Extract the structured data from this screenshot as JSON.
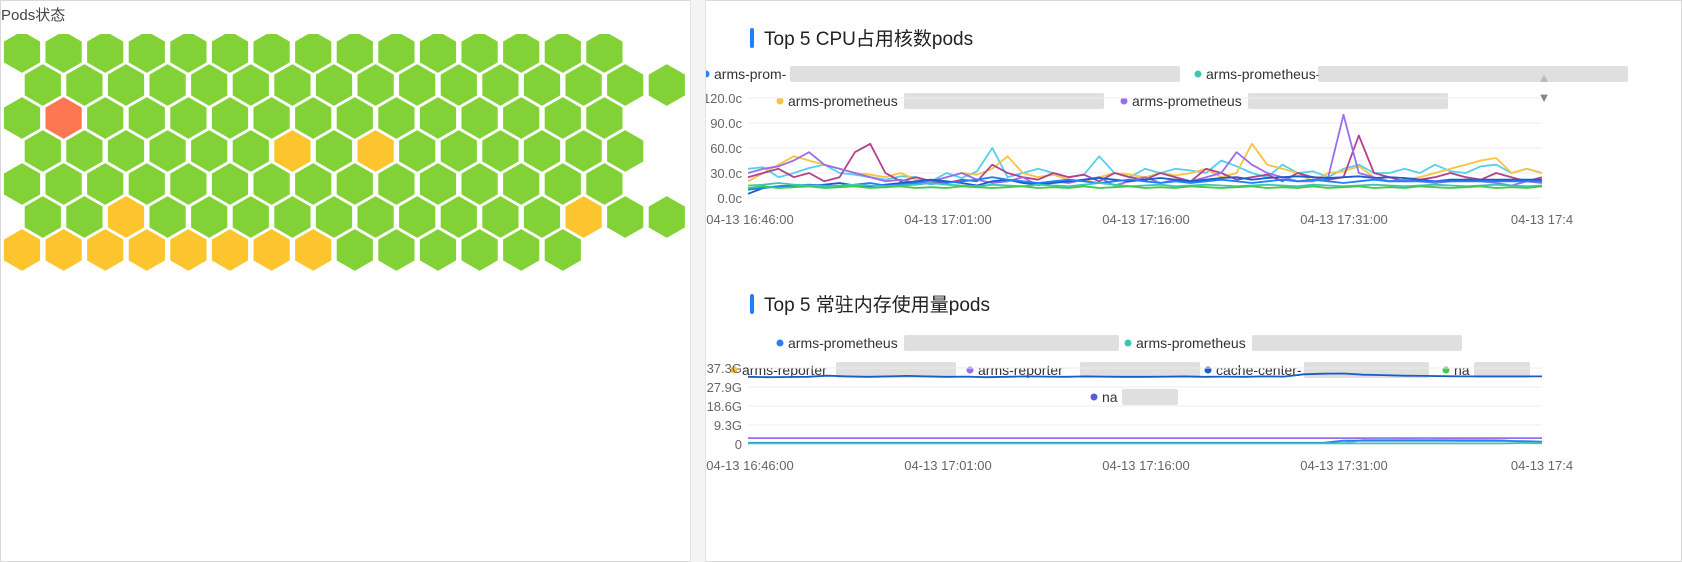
{
  "pods_panel": {
    "title": "Pods状态",
    "status_colors": {
      "running": "#82d136",
      "warning": "#fcc42d",
      "error": "#fc7752"
    },
    "rows": [
      "ggggggggggggggg",
      "gggggggggggggggg",
      "geggggggggggggg",
      "ggggggwgwgggggg",
      "ggggggggggggggg",
      "ggwggggggggggwggg",
      "wwwwwwwwgggggg"
    ]
  },
  "cpu_chart": {
    "title": "Top 5 CPU占用核数pods",
    "legend": [
      {
        "label": "arms-prom-",
        "color": "#2f7ef0"
      },
      {
        "label": "arms-prometheus-",
        "color": "#3cc7b4"
      },
      {
        "label": "arms-prometheus",
        "color": "#f7c340"
      },
      {
        "label": "arms-prometheus",
        "color": "#9a6cf0"
      }
    ],
    "legend_pager": {
      "up": "▲",
      "down": "▼"
    },
    "chart_data": {
      "type": "line",
      "y_ticks": [
        "120.0c",
        "90.0c",
        "60.0c",
        "30.0c",
        "0.0c"
      ],
      "x_ticks": [
        "04-13 16:46:00",
        "04-13 17:01:00",
        "04-13 17:16:00",
        "04-13 17:31:00",
        "04-13 17:4"
      ],
      "ylim": [
        0,
        120
      ],
      "series": [
        {
          "color": "#55d0ec",
          "values": [
            35,
            37,
            25,
            30,
            36,
            40,
            30,
            28,
            25,
            22,
            26,
            25,
            20,
            30,
            24,
            32,
            60,
            25,
            30,
            35,
            30,
            25,
            28,
            50,
            30,
            25,
            35,
            30,
            35,
            33,
            30,
            45,
            38,
            30,
            25,
            40,
            30,
            32,
            25,
            35,
            40,
            30,
            30,
            35,
            30,
            40,
            32,
            30,
            38,
            40,
            30,
            35,
            30
          ]
        },
        {
          "color": "#f7c340",
          "values": [
            20,
            30,
            40,
            50,
            45,
            40,
            35,
            30,
            28,
            25,
            30,
            22,
            20,
            25,
            30,
            28,
            35,
            50,
            30,
            25,
            28,
            22,
            20,
            25,
            30,
            28,
            25,
            30,
            27,
            30,
            35,
            25,
            30,
            65,
            40,
            35,
            30,
            20,
            30,
            32,
            38,
            25,
            20,
            22,
            25,
            30,
            35,
            40,
            45,
            48,
            30,
            35,
            30
          ]
        },
        {
          "color": "#b5418c",
          "values": [
            25,
            30,
            35,
            25,
            30,
            20,
            25,
            55,
            65,
            30,
            20,
            25,
            20,
            18,
            22,
            20,
            40,
            30,
            25,
            22,
            30,
            25,
            28,
            20,
            30,
            25,
            22,
            30,
            25,
            20,
            35,
            30,
            22,
            25,
            28,
            20,
            30,
            25,
            22,
            25,
            75,
            30,
            25,
            20,
            22,
            25,
            30,
            25,
            22,
            30,
            25,
            20,
            25
          ]
        },
        {
          "color": "#9a6cf0",
          "values": [
            30,
            35,
            38,
            45,
            55,
            40,
            35,
            30,
            25,
            20,
            22,
            18,
            20,
            25,
            30,
            22,
            18,
            20,
            25,
            15,
            20,
            18,
            22,
            25,
            15,
            20,
            25,
            18,
            22,
            20,
            25,
            30,
            55,
            40,
            30,
            25,
            20,
            20,
            25,
            100,
            30,
            25,
            20,
            22,
            20,
            18,
            20,
            22,
            20,
            18,
            15,
            20,
            18
          ]
        },
        {
          "color": "#1a5cc8",
          "values": [
            5,
            12,
            14,
            15,
            14,
            16,
            18,
            15,
            14,
            16,
            18,
            20,
            22,
            20,
            18,
            15,
            20,
            22,
            18,
            16,
            18,
            20,
            22,
            24,
            22,
            20,
            22,
            24,
            22,
            20,
            22,
            24,
            25,
            22,
            24,
            25,
            26,
            25,
            24,
            25,
            26,
            24,
            25,
            24,
            22,
            20,
            22,
            22,
            22,
            22,
            22,
            22,
            22
          ]
        },
        {
          "color": "#1e80ff",
          "values": [
            10,
            12,
            14,
            15,
            16,
            15,
            14,
            16,
            18,
            15,
            16,
            18,
            17,
            18,
            20,
            22,
            25,
            22,
            20,
            18,
            20,
            22,
            20,
            18,
            20,
            22,
            20,
            18,
            20,
            18,
            20,
            22,
            20,
            18,
            20,
            22,
            20,
            22,
            20,
            18,
            20,
            22,
            20,
            20,
            20,
            20,
            20,
            20,
            20,
            20,
            20,
            20,
            20
          ]
        },
        {
          "color": "#3cc7b4",
          "values": [
            15,
            16,
            18,
            16,
            15,
            14,
            15,
            16,
            15,
            14,
            15,
            16,
            18,
            16,
            15,
            14,
            16,
            15,
            14,
            16,
            15,
            14,
            16,
            18,
            16,
            14,
            15,
            16,
            14,
            15,
            16,
            15,
            14,
            15,
            16,
            15,
            14,
            16,
            15,
            14,
            15,
            16,
            15,
            14,
            15,
            16,
            15,
            14,
            15,
            16,
            15,
            14,
            15
          ]
        },
        {
          "color": "#42c94b",
          "values": [
            12,
            14,
            12,
            13,
            14,
            12,
            13,
            14,
            12,
            13,
            14,
            12,
            13,
            12,
            14,
            13,
            12,
            13,
            14,
            12,
            13,
            12,
            14,
            12,
            13,
            14,
            12,
            13,
            12,
            14,
            13,
            12,
            13,
            14,
            12,
            13,
            12,
            14,
            12,
            13,
            14,
            12,
            13,
            12,
            14,
            13,
            12,
            13,
            14,
            12,
            13,
            12,
            14
          ]
        }
      ]
    }
  },
  "mem_chart": {
    "title": "Top 5 常驻内存使用量pods",
    "legend": [
      {
        "label": "arms-prometheus",
        "color": "#2f7ef0"
      },
      {
        "label": "arms-prometheus",
        "color": "#3cc7b4"
      },
      {
        "label": "arms-reporter",
        "color": "#f7c340"
      },
      {
        "label": "arms-reporter",
        "color": "#9a6cf0"
      },
      {
        "label": "cache-center-",
        "color": "#1a5cc8"
      },
      {
        "label": "na",
        "color": "#42c94b"
      },
      {
        "label": "na",
        "color": "#5a5bd6"
      }
    ],
    "chart_data": {
      "type": "line",
      "y_ticks": [
        "37.3G",
        "27.9G",
        "18.6G",
        "9.3G",
        "0"
      ],
      "x_ticks": [
        "04-13 16:46:00",
        "04-13 17:01:00",
        "04-13 17:16:00",
        "04-13 17:31:00",
        "04-13 17:4"
      ],
      "ylim": [
        0,
        37.3
      ],
      "series": [
        {
          "color": "#1a5cc8",
          "values": [
            33,
            32.8,
            32.9,
            33,
            33.5,
            33.2,
            33,
            33.2,
            33.4,
            33.2,
            33,
            33.1,
            32.8,
            33,
            33.2,
            33.1,
            33,
            33.2,
            33.1,
            33,
            33,
            33.1,
            33.2,
            33,
            33.1,
            33,
            33.2,
            33.1,
            34.2,
            34.5,
            34.6,
            34,
            33.8,
            33.5,
            33.4,
            33.3,
            33.2,
            33.2,
            33.2,
            33.2,
            33.2
          ]
        },
        {
          "color": "#9a6cf0",
          "values": [
            2.9,
            2.9,
            2.9,
            2.9,
            2.9,
            2.9,
            2.9,
            2.9,
            2.9,
            2.9,
            2.9,
            2.9,
            2.9,
            2.9,
            2.9,
            2.9,
            2.9,
            2.9,
            2.9,
            2.9,
            2.9,
            2.9,
            2.9,
            2.9,
            2.9,
            2.9,
            2.9,
            2.9,
            2.9,
            2.9,
            2.9,
            2.9,
            2.9,
            2.9,
            2.9,
            2.9,
            2.9,
            2.9,
            2.9,
            2.9,
            2.9
          ]
        },
        {
          "color": "#55d0ec",
          "values": [
            0.5,
            0.5,
            0.5,
            0.5,
            0.5,
            0.5,
            0.5,
            0.5,
            0.5,
            0.5,
            0.5,
            0.5,
            0.5,
            0.5,
            0.5,
            0.5,
            0.5,
            0.5,
            0.5,
            0.5,
            0.5,
            0.5,
            0.5,
            0.5,
            0.5,
            0.5,
            0.5,
            0.5,
            0.5,
            0.5,
            0.5,
            2.0,
            2.2,
            2.0,
            2.1,
            2.0,
            2.0,
            2.0,
            1.9,
            1.0,
            0.8
          ]
        },
        {
          "color": "#2f7ef0",
          "values": [
            0.6,
            0.6,
            0.6,
            0.6,
            0.6,
            0.6,
            0.6,
            0.6,
            0.6,
            0.6,
            0.6,
            0.6,
            0.6,
            0.6,
            0.6,
            0.6,
            0.6,
            0.6,
            0.6,
            0.6,
            0.6,
            0.6,
            0.6,
            0.6,
            0.6,
            0.6,
            0.6,
            0.6,
            0.6,
            0.6,
            1.6,
            1.6,
            1.6,
            1.6,
            1.6,
            1.6,
            1.5,
            1.5,
            1.5,
            1.4,
            1.2
          ]
        },
        {
          "color": "#3cc7b4",
          "values": [
            0.3,
            0.3,
            0.3,
            0.3,
            0.3,
            0.3,
            0.3,
            0.3,
            0.3,
            0.3,
            0.3,
            0.3,
            0.3,
            0.3,
            0.3,
            0.3,
            0.3,
            0.3,
            0.3,
            0.3,
            0.3,
            0.3,
            0.3,
            0.3,
            0.3,
            0.3,
            0.3,
            0.3,
            0.3,
            0.3,
            0.3,
            0.3,
            0.3,
            0.3,
            0.3,
            0.3,
            0.3,
            0.3,
            0.3,
            0.5,
            0.4
          ]
        }
      ]
    }
  }
}
